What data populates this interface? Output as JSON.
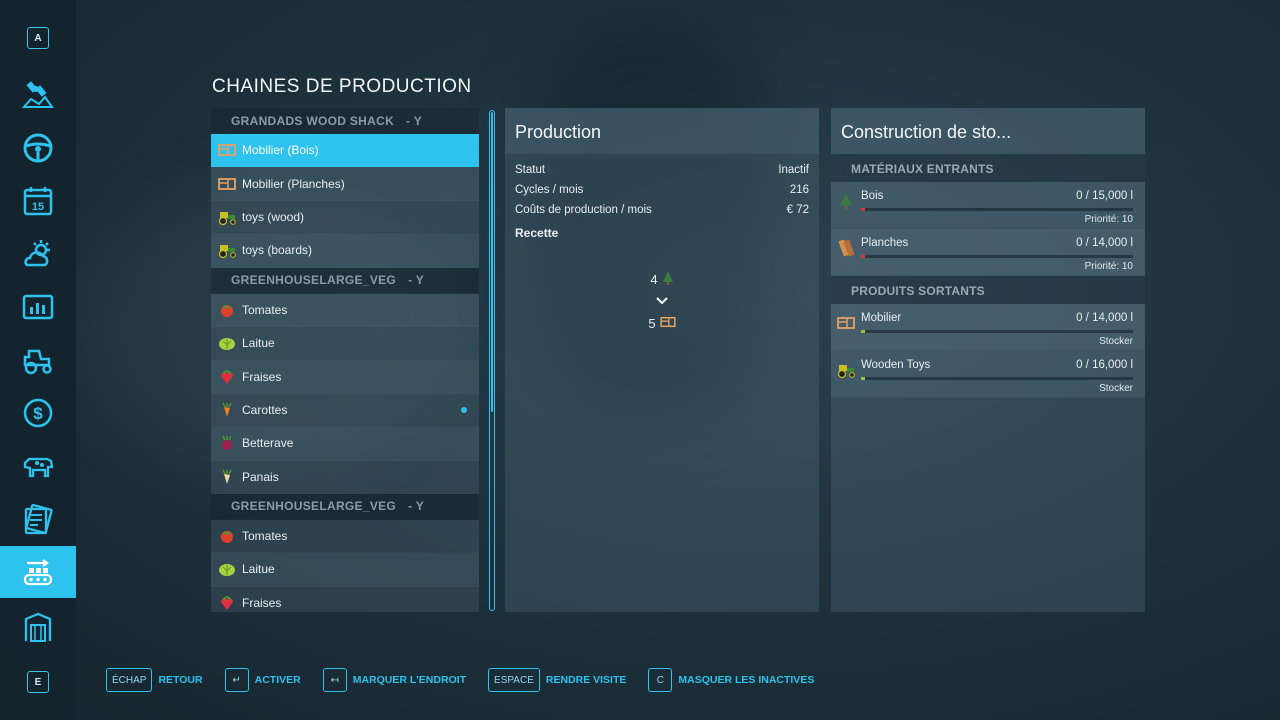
{
  "sidebar": {
    "top_key": "A",
    "bottom_key": "E",
    "items": [
      {
        "icon": "satellite-map-icon"
      },
      {
        "icon": "steering-wheel-icon"
      },
      {
        "icon": "calendar-icon",
        "label": "15"
      },
      {
        "icon": "weather-icon"
      },
      {
        "icon": "statistics-icon"
      },
      {
        "icon": "tractor-icon"
      },
      {
        "icon": "finances-icon"
      },
      {
        "icon": "animals-icon"
      },
      {
        "icon": "contracts-icon"
      },
      {
        "icon": "production-icon",
        "active": true
      },
      {
        "icon": "storage-icon"
      }
    ]
  },
  "page": {
    "title": "CHAINES DE PRODUCTION"
  },
  "list": {
    "groups": [
      {
        "name": "GRANDADS WOOD SHACK",
        "suffix": "- Y",
        "items": [
          {
            "label": "Mobilier (Bois)",
            "icon": "furniture-icon",
            "selected": true
          },
          {
            "label": "Mobilier (Planches)",
            "icon": "furniture-icon"
          },
          {
            "label": "toys (wood)",
            "icon": "toy-tractor-icon"
          },
          {
            "label": "toys (boards)",
            "icon": "toy-tractor-icon"
          }
        ]
      },
      {
        "name": "GREENHOUSELARGE_VEG",
        "suffix": "- Y",
        "items": [
          {
            "label": "Tomates",
            "icon": "tomato-icon"
          },
          {
            "label": "Laitue",
            "icon": "lettuce-icon"
          },
          {
            "label": "Fraises",
            "icon": "strawberry-icon"
          },
          {
            "label": "Carottes",
            "icon": "carrot-icon",
            "active_dot": true
          },
          {
            "label": "Betterave",
            "icon": "beet-icon"
          },
          {
            "label": "Panais",
            "icon": "parsnip-icon"
          }
        ]
      },
      {
        "name": "GREENHOUSELARGE_VEG",
        "suffix": "- Y",
        "items": [
          {
            "label": "Tomates",
            "icon": "tomato-icon"
          },
          {
            "label": "Laitue",
            "icon": "lettuce-icon"
          },
          {
            "label": "Fraises",
            "icon": "strawberry-icon"
          }
        ]
      }
    ]
  },
  "production": {
    "title": "Production",
    "stats": [
      {
        "label": "Statut",
        "value": "Inactif"
      },
      {
        "label": "Cycles / mois",
        "value": "216"
      },
      {
        "label": "Coûts de production / mois",
        "value": "€ 72"
      }
    ],
    "recipe_label": "Recette",
    "recipe": {
      "input_amount": "4",
      "input_icon": "tree-icon",
      "output_amount": "5",
      "output_icon": "furniture-icon"
    }
  },
  "storage": {
    "title": "Construction de sto...",
    "inputs_header": "MATÉRIAUX ENTRANTS",
    "inputs": [
      {
        "name": "Bois",
        "value": "0  / 15,000 l",
        "note": "Priorité: 10",
        "icon": "tree-icon",
        "fill_color": "#e03030"
      },
      {
        "name": "Planches",
        "value": "0  / 14,000 l",
        "note": "Priorité: 10",
        "icon": "planks-icon",
        "fill_color": "#e03030"
      }
    ],
    "outputs_header": "PRODUITS SORTANTS",
    "outputs": [
      {
        "name": "Mobilier",
        "value": "0  / 14,000 l",
        "note": "Stocker",
        "icon": "furniture-icon",
        "fill_color": "#8ccc30"
      },
      {
        "name": "Wooden Toys",
        "value": "0  / 16,000 l",
        "note": "Stocker",
        "icon": "toy-tractor-icon",
        "fill_color": "#8ccc30"
      }
    ]
  },
  "footer": [
    {
      "key": "ÉCHAP",
      "label": "RETOUR"
    },
    {
      "key": "↵",
      "label": "ACTIVER"
    },
    {
      "key": "↤",
      "label": "MARQUER L'ENDROIT"
    },
    {
      "key": "ESPACE",
      "label": "RENDRE VISITE"
    },
    {
      "key": "C",
      "label": "MASQUER LES INACTIVES"
    }
  ],
  "colors": {
    "accent": "#2ec3ee",
    "panel": "#46606e"
  }
}
